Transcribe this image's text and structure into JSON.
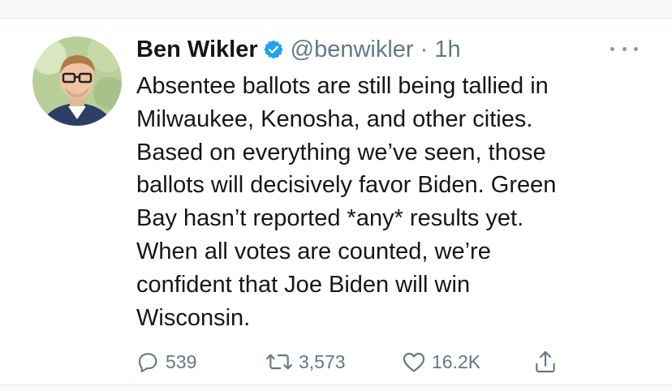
{
  "tweet": {
    "author": {
      "name": "Ben Wikler",
      "handle": "@benwikler",
      "verified": true
    },
    "separator": "·",
    "time": "1h",
    "body_lines": [
      "Absentee ballots are still being tallied in",
      "Milwaukee, Kenosha, and other cities.",
      "Based on everything we’ve seen, those",
      "ballots will decisively favor Biden. Green",
      "Bay hasn’t reported *any* results yet.",
      "When all votes are counted, we’re",
      "confident that Joe Biden will win",
      "Wisconsin."
    ],
    "stats": {
      "replies": "539",
      "retweets": "3,573",
      "likes": "16.2K"
    }
  },
  "icons": {
    "verified": "verified-badge-icon",
    "more": "more-options-icon",
    "reply": "reply-icon",
    "retweet": "retweet-icon",
    "like": "heart-icon",
    "share": "share-icon"
  },
  "colors": {
    "text_primary": "#14171a",
    "text_secondary": "#657786",
    "verified_blue": "#1da1f2"
  }
}
